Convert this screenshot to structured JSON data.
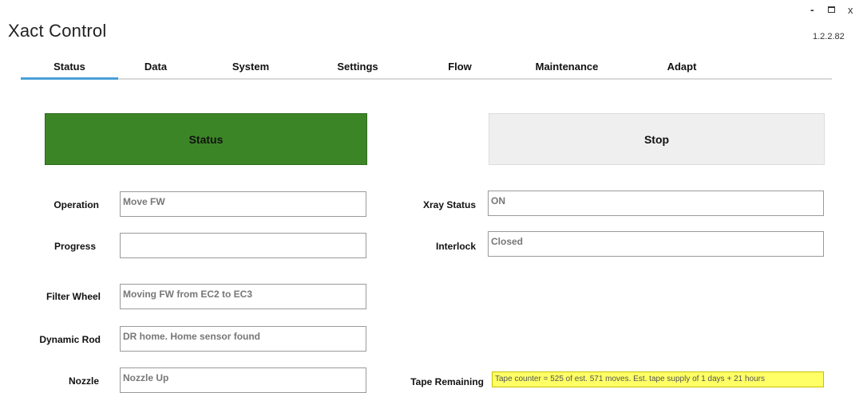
{
  "window": {
    "title": "Xact Control",
    "version": "1.2.2.82",
    "minimize": "-",
    "close": "x"
  },
  "tabs": [
    {
      "label": "Status",
      "active": true
    },
    {
      "label": "Data"
    },
    {
      "label": "System"
    },
    {
      "label": "Settings"
    },
    {
      "label": "Flow"
    },
    {
      "label": "Maintenance"
    },
    {
      "label": "Adapt"
    }
  ],
  "buttons": {
    "status_label": "Status",
    "stop_label": "Stop"
  },
  "fields": {
    "operation": {
      "label": "Operation",
      "value": "Move FW"
    },
    "progress": {
      "label": "Progress",
      "value": ""
    },
    "filter_wheel": {
      "label": "Filter Wheel",
      "value": "Moving FW from EC2 to EC3"
    },
    "dynamic_rod": {
      "label": "Dynamic Rod",
      "value": "DR home.  Home sensor found"
    },
    "nozzle": {
      "label": "Nozzle",
      "value": "Nozzle Up"
    },
    "xray_status": {
      "label": "Xray Status",
      "value": "ON"
    },
    "interlock": {
      "label": "Interlock",
      "value": "Closed"
    },
    "tape_remaining": {
      "label": "Tape Remaining",
      "value": "Tape counter = 525 of est. 571 moves.  Est. tape supply of 1 days + 21 hours"
    }
  },
  "colors": {
    "status_green": "#3c8526",
    "tab_accent": "#4a9fd8",
    "tape_highlight": "#ffff66"
  }
}
